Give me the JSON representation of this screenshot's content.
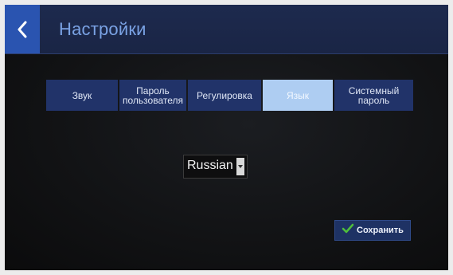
{
  "header": {
    "title": "Настройки",
    "back_icon": "chevron-left-icon"
  },
  "tabs": [
    {
      "label": "Звук",
      "active": false
    },
    {
      "label": "Пароль\nпользователя",
      "active": false
    },
    {
      "label": "Регулировка",
      "active": false
    },
    {
      "label": "Язык",
      "active": true
    },
    {
      "label": "Системный\nпароль",
      "active": false
    }
  ],
  "language": {
    "selected": "Russian",
    "dropdown_icon": "caret-down-icon"
  },
  "save_button": {
    "label": "Сохранить",
    "icon": "checkmark-icon"
  },
  "colors": {
    "header_bg": "#1d2a4e",
    "back_button": "#2a54b0",
    "title_text": "#7aa2e4",
    "tab_bg": "#213369",
    "tab_active_bg": "#aecdf2",
    "checkmark": "#4fbf3c"
  }
}
